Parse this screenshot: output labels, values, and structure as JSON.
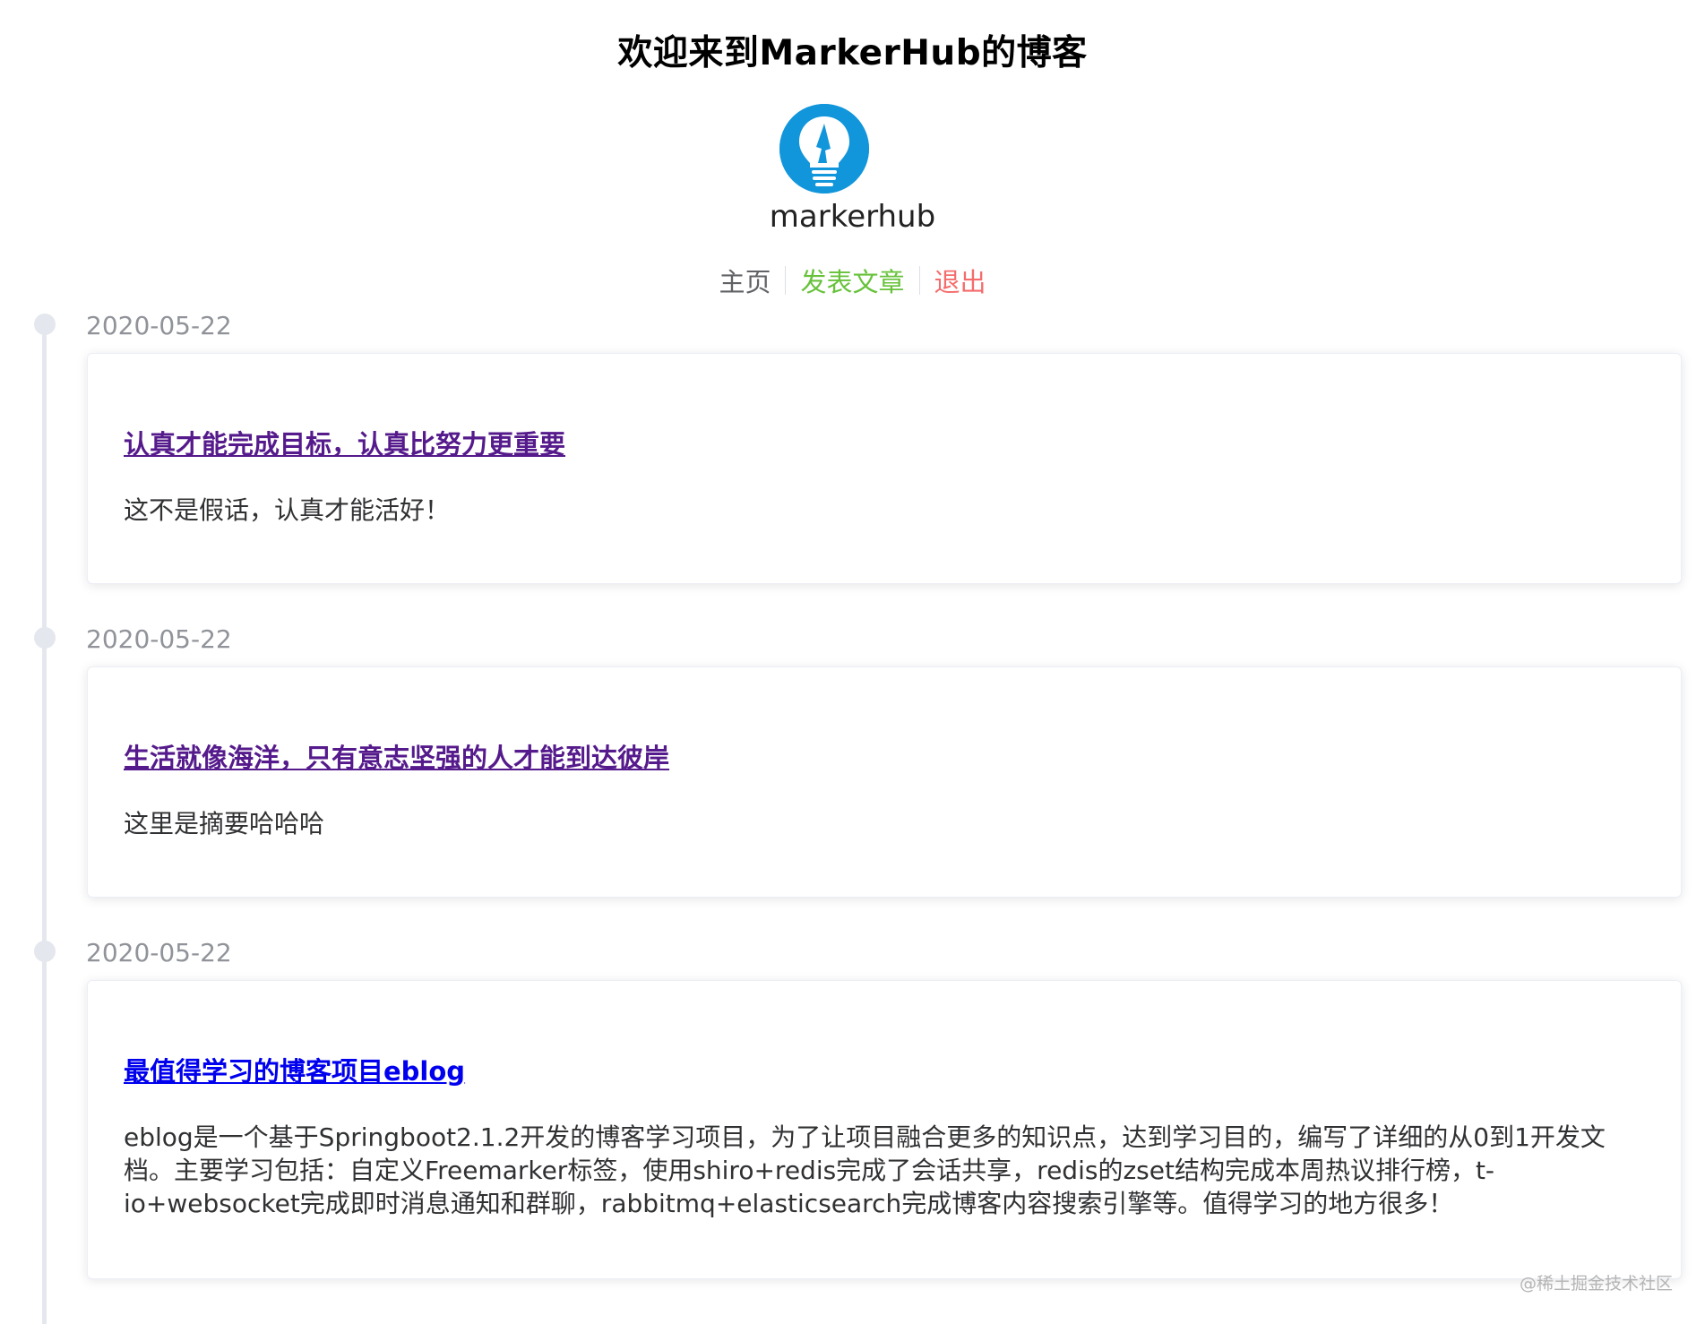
{
  "header": {
    "title": "欢迎来到MarkerHub的博客",
    "username": "markerhub"
  },
  "nav": {
    "home": "主页",
    "post": "发表文章",
    "logout": "退出"
  },
  "colors": {
    "post_link": "#67c23a",
    "logout_link": "#f56c6c",
    "avatar_bg": "#1296db",
    "visited_link": "#551a8b",
    "unvisited_link": "#0000ee"
  },
  "blogs": [
    {
      "date": "2020-05-22",
      "title": "认真才能完成目标，认真比努力更重要",
      "description": "这不是假话，认真才能活好！"
    },
    {
      "date": "2020-05-22",
      "title": "生活就像海洋，只有意志坚强的人才能到达彼岸",
      "description": "这里是摘要哈哈哈"
    },
    {
      "date": "2020-05-22",
      "title": "最值得学习的博客项目eblog",
      "description": "eblog是一个基于Springboot2.1.2开发的博客学习项目，为了让项目融合更多的知识点，达到学习目的，编写了详细的从0到1开发文档。主要学习包括：自定义Freemarker标签，使用shiro+redis完成了会话共享，redis的zset结构完成本周热议排行榜，t-io+websocket完成即时消息通知和群聊，rabbitmq+elasticsearch完成博客内容搜索引擎等。值得学习的地方很多！"
    }
  ],
  "watermark": "@稀土掘金技术社区"
}
